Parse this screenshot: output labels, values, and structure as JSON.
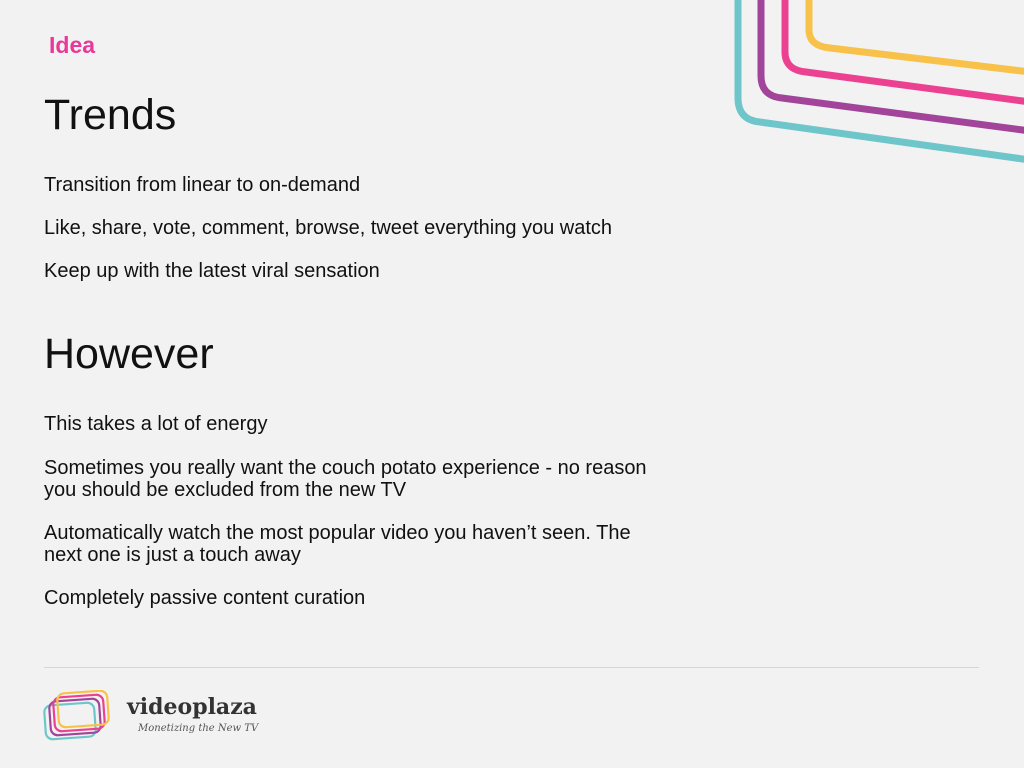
{
  "slide": {
    "section_label": "Idea",
    "trends": {
      "heading": "Trends",
      "points": [
        "Transition from linear to on-demand",
        "Like, share, vote, comment, browse, tweet everything you watch",
        "Keep up with the latest viral sensation"
      ]
    },
    "however": {
      "heading": "However",
      "points": [
        {
          "lines": [
            "This takes a lot of energy"
          ]
        },
        {
          "lines": [
            "Sometimes you really want the couch potato experience - no reason",
            "you should be excluded from the new TV"
          ]
        },
        {
          "lines": [
            "Automatically watch the most popular video you haven’t seen. The",
            "next one is just a touch away"
          ]
        },
        {
          "lines": [
            "Completely passive content curation"
          ]
        }
      ]
    }
  },
  "footer": {
    "brand_name": "videoplaza",
    "tagline": "Monetizing the New TV"
  },
  "colors": {
    "background": "#f2f2f2",
    "accent_pink": "#e8399a",
    "stripe_teal": "#6fc6ca",
    "stripe_purple": "#a2449a",
    "stripe_pink": "#ec4191",
    "stripe_yellow": "#f8c24a",
    "text": "#111111"
  },
  "icons": {
    "decoration": "corner-stripes",
    "logo": "videoplaza-frames-logo"
  }
}
